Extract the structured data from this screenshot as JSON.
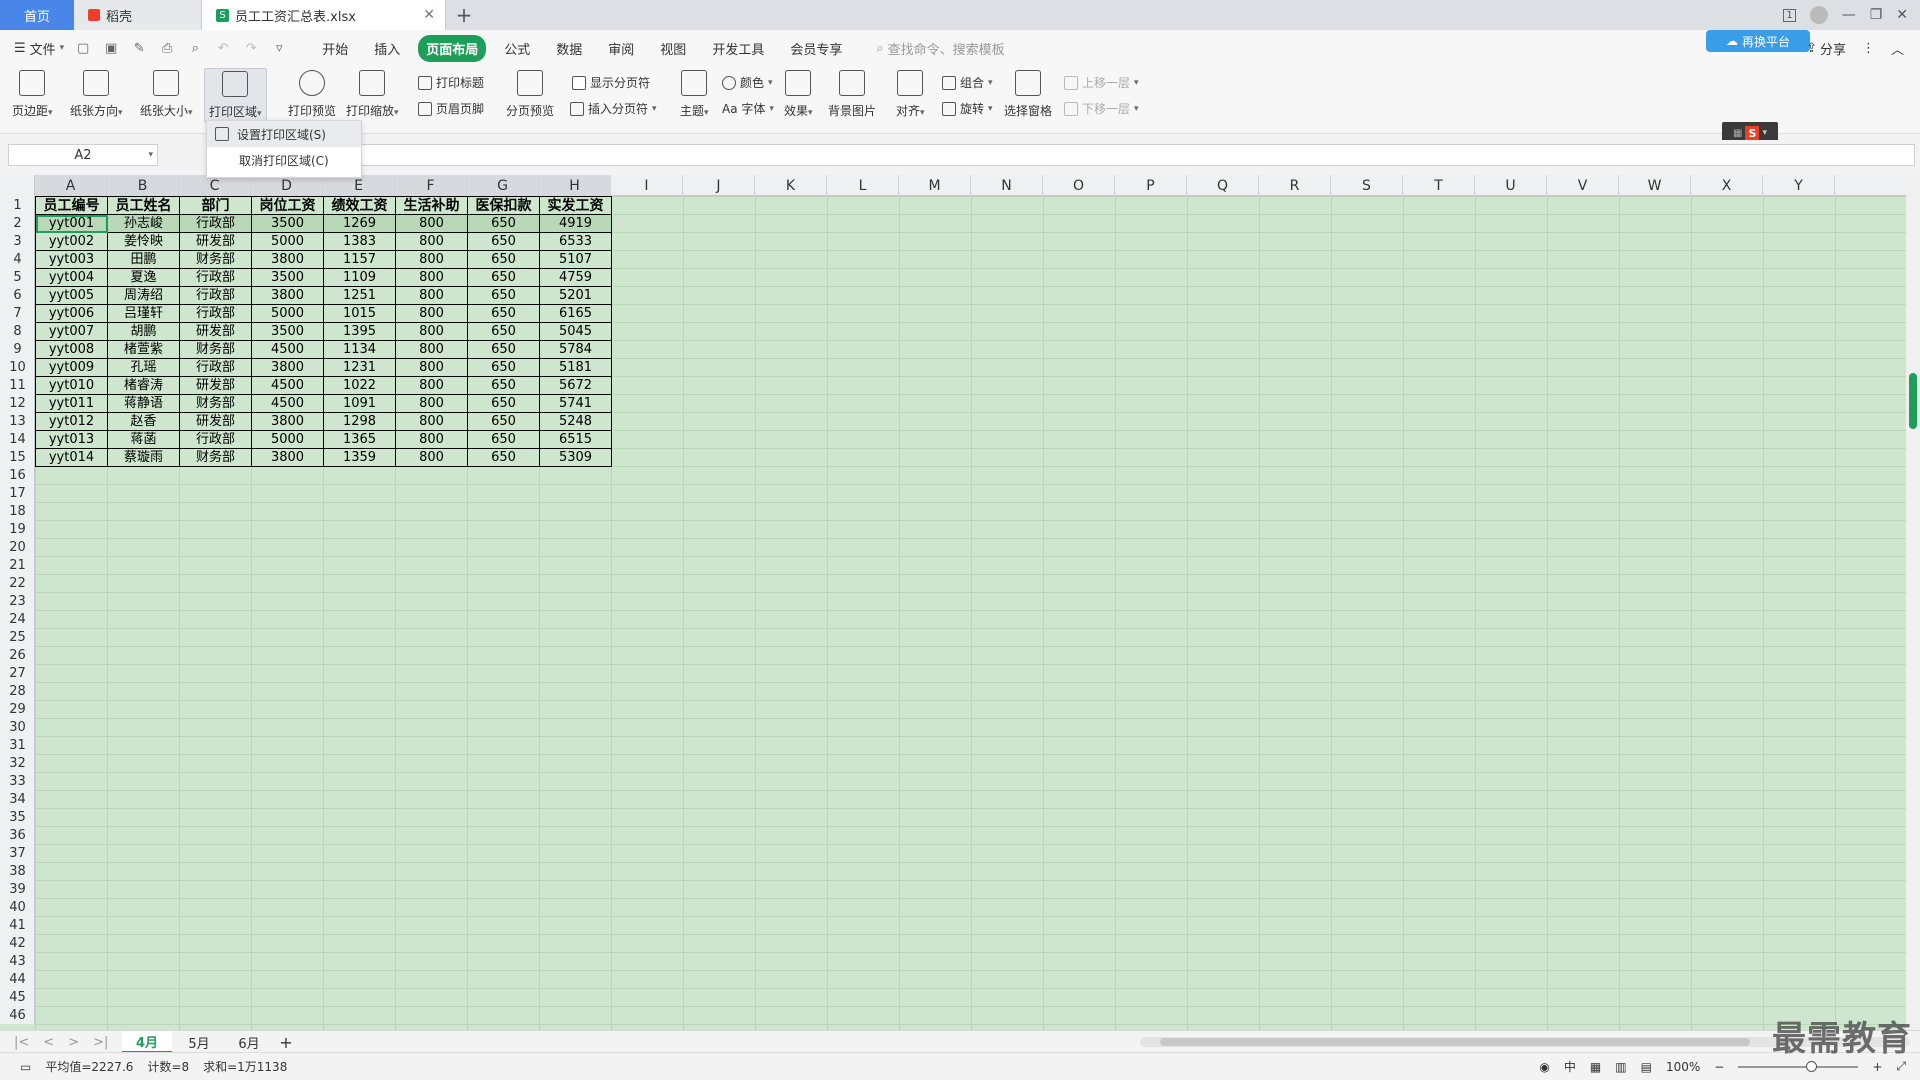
{
  "tabs": {
    "home": "首页",
    "items": [
      {
        "label": "稻壳",
        "icon": "daoke-icon"
      },
      {
        "label": "员工工资汇总表.xlsx",
        "icon": "sheet-file-icon"
      }
    ]
  },
  "menu": {
    "file": "文件",
    "items": [
      "开始",
      "插入",
      "页面布局",
      "公式",
      "数据",
      "审阅",
      "视图",
      "开发工具",
      "会员专享"
    ],
    "active_index": 2,
    "search_placeholder": "查找命令、搜索模板",
    "share": "分享",
    "cloud_pill": "再换平台"
  },
  "ribbon": {
    "margins": "页边距",
    "orientation": "纸张方向",
    "size": "纸张大小",
    "print_area": "打印区域",
    "print_preview": "打印预览",
    "print_scale": "打印缩放",
    "print_titles": "打印标题",
    "header_footer": "页眉页脚",
    "page_break_preview": "分页预览",
    "show_page_breaks": "显示分页符",
    "insert_page_break": "插入分页符",
    "theme": "主题",
    "colors": "颜色",
    "fonts": "Aa 字体",
    "effects": "效果",
    "background": "背景图片",
    "align": "对齐",
    "group": "组合",
    "rotate": "旋转",
    "selection_pane": "选择窗格",
    "bring_forward": "上移一层",
    "send_backward": "下移一层"
  },
  "dropdown": {
    "set_print_area": "设置打印区域(S)",
    "clear_print_area": "取消打印区域(C)"
  },
  "formula_bar": {
    "name_box": "A2",
    "content": ""
  },
  "columns": [
    "A",
    "B",
    "C",
    "D",
    "E",
    "F",
    "G",
    "H",
    "I",
    "J",
    "K",
    "L",
    "M",
    "N",
    "O",
    "P",
    "Q",
    "R",
    "S",
    "T",
    "U",
    "V",
    "W",
    "X",
    "Y"
  ],
  "row_numbers": [
    "1",
    "2",
    "3",
    "4",
    "5",
    "6",
    "7",
    "8",
    "9",
    "10",
    "11",
    "12",
    "13",
    "14",
    "15",
    "16",
    "17",
    "18",
    "19",
    "20",
    "21",
    "22",
    "23",
    "24",
    "25",
    "26",
    "27",
    "28",
    "29",
    "30",
    "31",
    "32",
    "33",
    "34",
    "35",
    "36",
    "37",
    "38",
    "39",
    "40",
    "41",
    "42",
    "43",
    "44",
    "45",
    "46"
  ],
  "table": {
    "headers": [
      "员工编号",
      "员工姓名",
      "部门",
      "岗位工资",
      "绩效工资",
      "生活补助",
      "医保扣款",
      "实发工资"
    ],
    "rows": [
      [
        "yyt001",
        "孙志峻",
        "行政部",
        "3500",
        "1269",
        "800",
        "650",
        "4919"
      ],
      [
        "yyt002",
        "姜怜映",
        "研发部",
        "5000",
        "1383",
        "800",
        "650",
        "6533"
      ],
      [
        "yyt003",
        "田鹏",
        "财务部",
        "3800",
        "1157",
        "800",
        "650",
        "5107"
      ],
      [
        "yyt004",
        "夏逸",
        "行政部",
        "3500",
        "1109",
        "800",
        "650",
        "4759"
      ],
      [
        "yyt005",
        "周涛绍",
        "行政部",
        "3800",
        "1251",
        "800",
        "650",
        "5201"
      ],
      [
        "yyt006",
        "吕瑾轩",
        "行政部",
        "5000",
        "1015",
        "800",
        "650",
        "6165"
      ],
      [
        "yyt007",
        "胡鹏",
        "研发部",
        "3500",
        "1395",
        "800",
        "650",
        "5045"
      ],
      [
        "yyt008",
        "楮萱紫",
        "财务部",
        "4500",
        "1134",
        "800",
        "650",
        "5784"
      ],
      [
        "yyt009",
        "孔瑶",
        "行政部",
        "3800",
        "1231",
        "800",
        "650",
        "5181"
      ],
      [
        "yyt010",
        "楮睿涛",
        "研发部",
        "4500",
        "1022",
        "800",
        "650",
        "5672"
      ],
      [
        "yyt011",
        "蒋静语",
        "财务部",
        "4500",
        "1091",
        "800",
        "650",
        "5741"
      ],
      [
        "yyt012",
        "赵香",
        "研发部",
        "3800",
        "1298",
        "800",
        "650",
        "5248"
      ],
      [
        "yyt013",
        "蒋菡",
        "行政部",
        "5000",
        "1365",
        "800",
        "650",
        "6515"
      ],
      [
        "yyt014",
        "蔡璇雨",
        "财务部",
        "3800",
        "1359",
        "800",
        "650",
        "5309"
      ]
    ]
  },
  "sheet_tabs": [
    "4月",
    "5月",
    "6月"
  ],
  "active_sheet": 0,
  "status": {
    "average": "平均值=2227.6",
    "count": "计数=8",
    "sum": "求和=1万1138",
    "zoom": "100%",
    "input_mode": "中"
  },
  "watermark": "最需教育",
  "colors": {
    "accent": "#1e9e5b",
    "grid_bg": "#cde6cd",
    "home_tab": "#4a86e8"
  }
}
